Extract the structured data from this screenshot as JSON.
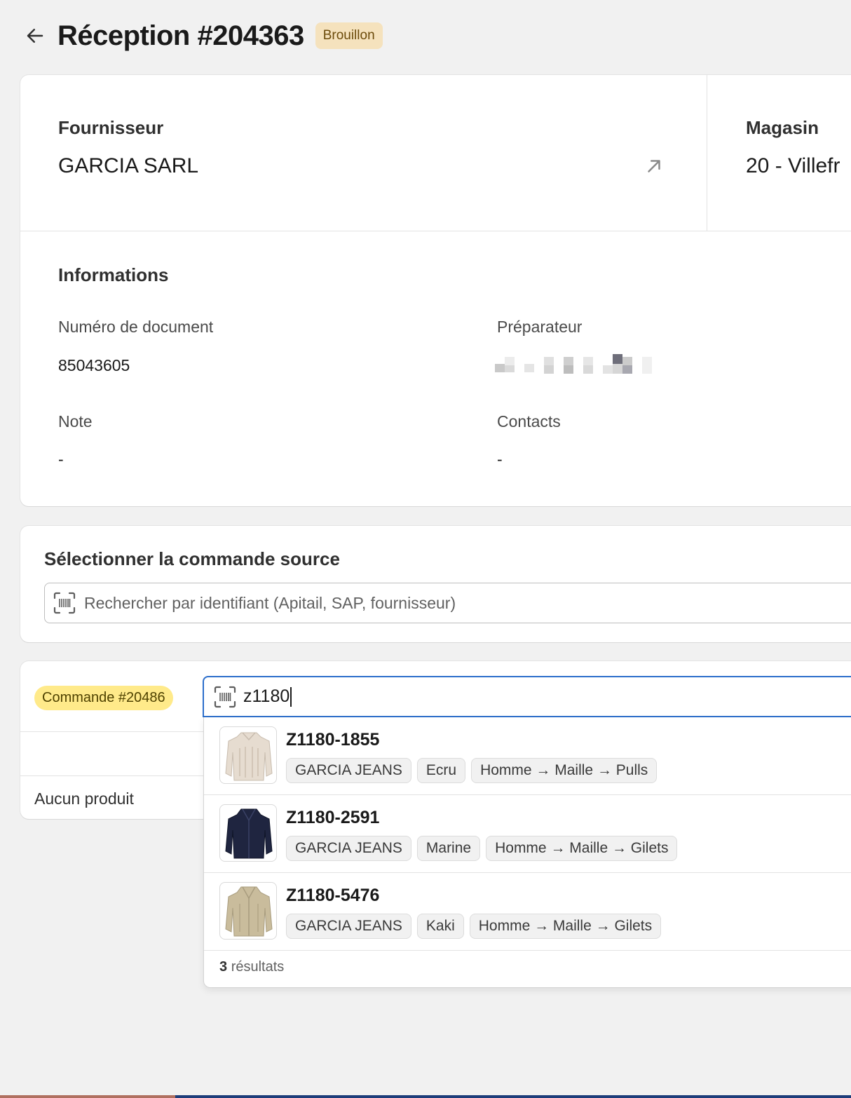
{
  "header": {
    "title": "Réception #204363",
    "status": "Brouillon"
  },
  "supplier": {
    "label": "Fournisseur",
    "value": "GARCIA SARL"
  },
  "store": {
    "label": "Magasin",
    "value": "20 - Villefr"
  },
  "informations": {
    "title": "Informations",
    "document_number_label": "Numéro de document",
    "document_number": "85043605",
    "preparer_label": "Préparateur",
    "note_label": "Note",
    "note": "-",
    "contacts_label": "Contacts",
    "contacts": "-"
  },
  "source_order": {
    "title": "Sélectionner la commande source",
    "search_placeholder": "Rechercher par identifiant (Apitail, SAP, fournisseur)"
  },
  "order": {
    "badge": "Commande #20486",
    "empty_text": "Aucun produit",
    "search_value": "z1180"
  },
  "results": [
    {
      "ref": "Z1180-1855",
      "brand": "GARCIA JEANS",
      "color": "Ecru",
      "category": "Homme → Maille → Pulls",
      "thumb_color": "#e6dcd0"
    },
    {
      "ref": "Z1180-2591",
      "brand": "GARCIA JEANS",
      "color": "Marine",
      "category": "Homme → Maille → Gilets",
      "thumb_color": "#1f2540"
    },
    {
      "ref": "Z1180-5476",
      "brand": "GARCIA JEANS",
      "color": "Kaki",
      "category": "Homme → Maille → Gilets",
      "thumb_color": "#c9bc9c"
    }
  ],
  "results_count": {
    "number": "3",
    "label": "résultats"
  }
}
